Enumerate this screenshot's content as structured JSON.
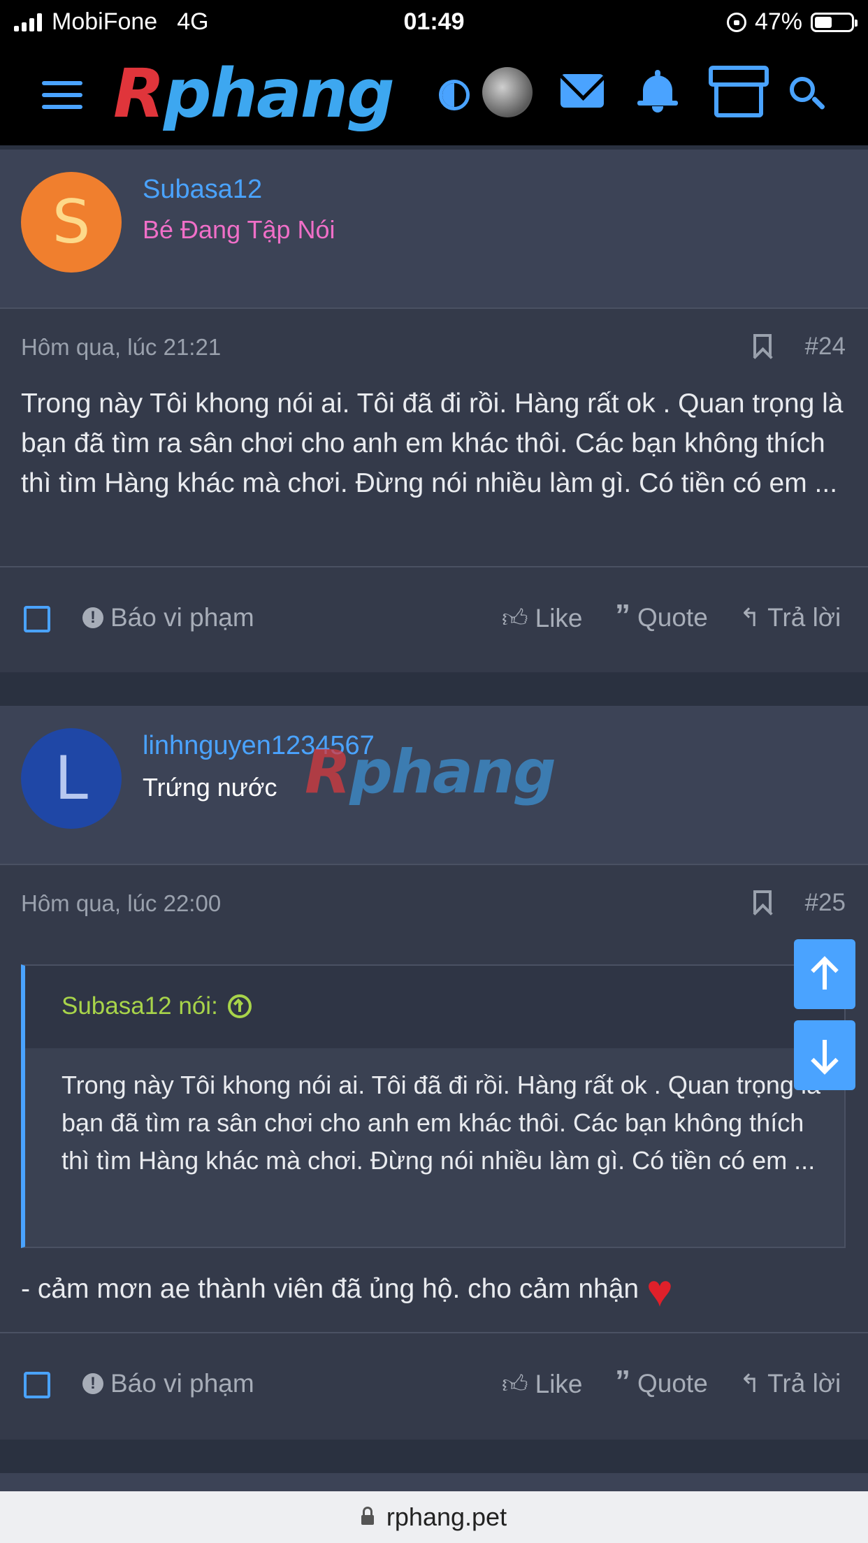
{
  "status_bar": {
    "carrier": "MobiFone",
    "network": "4G",
    "time": "01:49",
    "battery": "47%",
    "battery_level": 0.47
  },
  "nav": {
    "logo_first": "R",
    "logo_rest": "phang",
    "icons": [
      "menu-icon",
      "contrast-icon",
      "avatar",
      "mail-icon",
      "bell-icon",
      "store-icon",
      "search-icon"
    ],
    "accent_color": "#4aa3ff"
  },
  "posts": [
    {
      "avatar_letter": "S",
      "avatar_color": "#f07f2e",
      "avatar_text_color": "#fdd98a",
      "username": "Subasa12",
      "user_title": "Bé Đang Tập Nói",
      "user_title_color": "#f06fc8",
      "date": "Hôm qua, lúc 21:21",
      "number": "#24",
      "body": "Trong này Tôi khong nói ai. Tôi đã đi rồi. Hàng rất ok . Quan trọng là bạn đã tìm ra sân chơi cho anh em khác thôi. Các bạn không thích thì tìm Hàng khác mà chơi. Đừng nói nhiều làm gì. Có tiền có em ..."
    },
    {
      "avatar_letter": "L",
      "avatar_color": "#1f47a6",
      "avatar_text_color": "#b7c8f0",
      "username": "linhnguyen1234567",
      "user_title": "Trứng nước",
      "user_title_color": "#ffffff",
      "date": "Hôm qua, lúc 22:00",
      "number": "#25",
      "quote": {
        "author": "Subasa12 nói:",
        "text": "Trong này Tôi khong nói ai. Tôi đã đi rồi. Hàng rất ok . Quan trọng là bạn đã tìm ra sân chơi cho anh em khác thôi. Các bạn không thích thì tìm Hàng khác mà chơi. Đừng nói nhiều làm gì. Có tiền có em ..."
      },
      "body": "- cảm mơn ae thành viên đã ủng hộ. cho cảm nhận"
    }
  ],
  "actions": {
    "report": "Báo vi phạm",
    "like": "Like",
    "quote": "Quote",
    "reply": "Trả lời"
  },
  "url": "rphang.pet"
}
